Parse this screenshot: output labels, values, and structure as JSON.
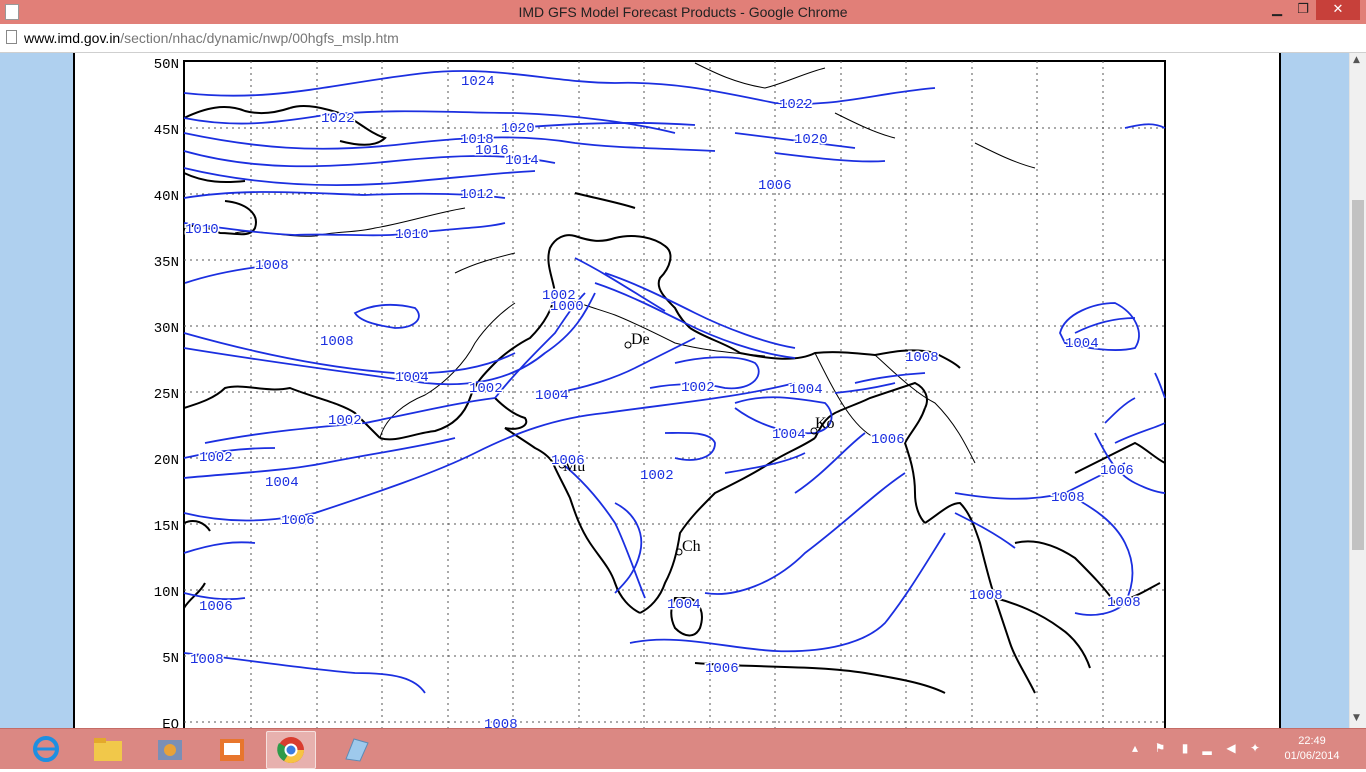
{
  "window": {
    "title": "IMD GFS Model Forecast Products - Google Chrome",
    "minimize": "▁",
    "maximize": "❐",
    "close": "✕"
  },
  "address": {
    "host": "www.imd.gov.in",
    "path": "/section/nhac/dynamic/nwp/00hgfs_mslp.htm"
  },
  "map": {
    "lat_labels": [
      "50N",
      "45N",
      "40N",
      "35N",
      "30N",
      "25N",
      "20N",
      "15N",
      "10N",
      "5N",
      "EQ"
    ],
    "city_labels": [
      "De",
      "Mu",
      "Ch",
      "Ko"
    ],
    "isobar_labels": [
      "1024",
      "1022",
      "1022",
      "1020",
      "1020",
      "1018",
      "1016",
      "1014",
      "1012",
      "1010",
      "1010",
      "1008",
      "1008",
      "1006",
      "1004",
      "1004",
      "1004",
      "1004",
      "1004",
      "1004",
      "1004",
      "1002",
      "1002",
      "1002",
      "1002",
      "1002",
      "1002",
      "1000",
      "1006",
      "1006",
      "1006",
      "1006",
      "1006",
      "1006",
      "1008",
      "1008",
      "1008",
      "1008",
      "1008",
      "1008"
    ],
    "isobar_color": "#1b2fe0"
  },
  "taskbar": {
    "apps": [
      "internet-explorer",
      "file-explorer",
      "app-3",
      "app-4",
      "chrome",
      "app-6"
    ],
    "time": "22:49",
    "date": "01/06/2014"
  }
}
